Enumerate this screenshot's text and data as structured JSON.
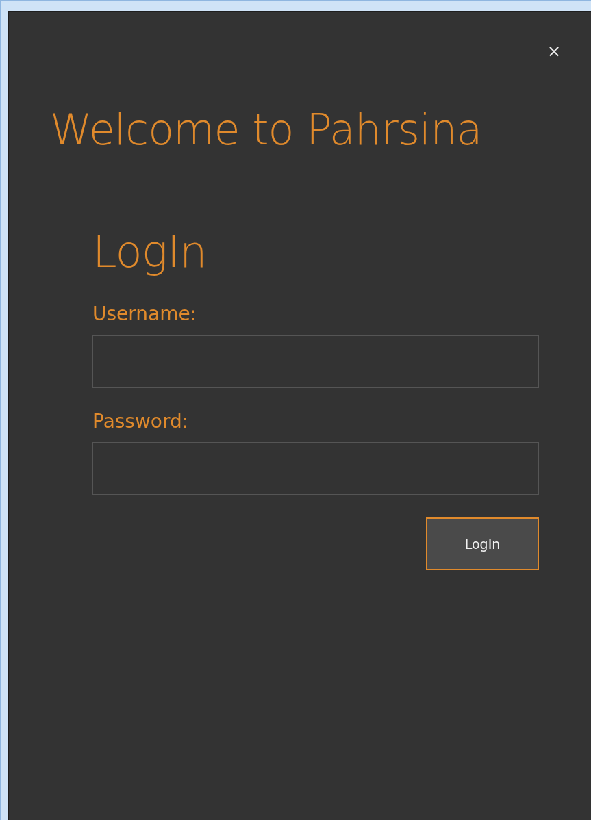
{
  "window": {
    "close": "×"
  },
  "welcome": "Welcome to Pahrsina",
  "login": {
    "heading": "LogIn",
    "fields": [
      {
        "label": "Username:"
      },
      {
        "label": "Password:"
      }
    ],
    "button": "LogIn"
  }
}
